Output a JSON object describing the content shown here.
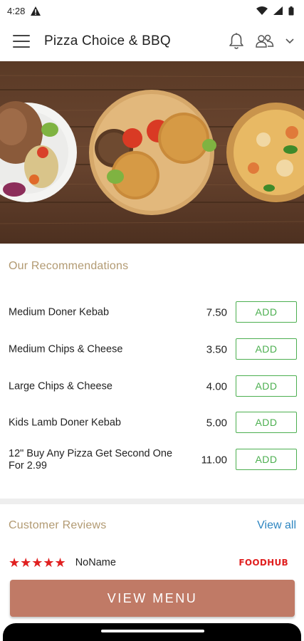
{
  "status": {
    "time": "4:28"
  },
  "appbar": {
    "title": "Pizza Choice & BBQ"
  },
  "recommendations": {
    "title": "Our Recommendations",
    "items": [
      {
        "name": "Medium Doner Kebab",
        "price": "7.50",
        "add_label": "ADD"
      },
      {
        "name": "Medium Chips & Cheese",
        "price": "3.50",
        "add_label": "ADD"
      },
      {
        "name": "Large Chips & Cheese",
        "price": "4.00",
        "add_label": "ADD"
      },
      {
        "name": "Kids Lamb Doner Kebab",
        "price": "5.00",
        "add_label": "ADD"
      },
      {
        "name": "12\" Buy Any Pizza Get Second One For 2.99",
        "price": "11.00",
        "add_label": "ADD"
      }
    ]
  },
  "reviews": {
    "title": "Customer Reviews",
    "view_all": "View all",
    "first": {
      "stars": "★★★★★",
      "reviewer": "NoName",
      "source": "FOODHUB",
      "rating": 5
    }
  },
  "cta": {
    "label": "VIEW MENU"
  },
  "colors": {
    "accent": "#b29a72",
    "add_green": "#4caf50",
    "link_blue": "#2e86c1",
    "cta": "#c07a66",
    "star_red": "#e02020"
  }
}
